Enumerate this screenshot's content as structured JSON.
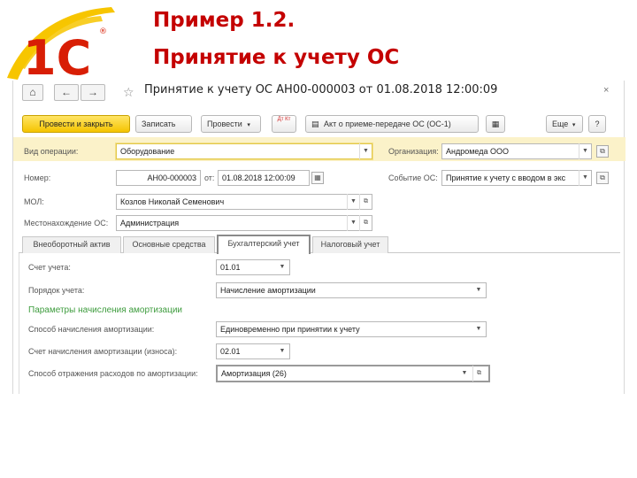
{
  "slide": {
    "title_line1": "Пример 1.2.",
    "title_line2": "Принятие к учету ОС",
    "logo_text": "1С",
    "logo_reg": "®"
  },
  "colors": {
    "title": "#c40000",
    "logo_red": "#d81e05",
    "logo_yellow": "#f7c500",
    "primary_button": "#f5c400"
  },
  "window": {
    "title": "Принятие к учету ОС АН00-000003 от 01.08.2018 12:00:09",
    "nav": {
      "home": "⌂",
      "back": "←",
      "forward": "→",
      "star": "☆",
      "close": "×"
    },
    "toolbar": {
      "post_close": "Провести и закрыть",
      "save": "Записать",
      "post": "Провести",
      "dt_kt": "Дт Кт",
      "act": "Акт о приеме-передаче ОС (ОС-1)",
      "more": "Еще",
      "help": "?"
    },
    "header": {
      "operation_label": "Вид операции:",
      "operation_value": "Оборудование",
      "organization_label": "Организация:",
      "organization_value": "Андромеда ООО",
      "number_label": "Номер:",
      "number_value": "АН00-000003",
      "from_label": "от:",
      "date_value": "01.08.2018 12:00:09",
      "event_label": "Событие ОС:",
      "event_value": "Принятие к учету с вводом в экс",
      "mol_label": "МОЛ:",
      "mol_value": "Козлов Николай Семенович",
      "location_label": "Местонахождение ОС:",
      "location_value": "Администрация"
    },
    "tabs": [
      "Внеоборотный актив",
      "Основные средства",
      "Бухгалтерский учет",
      "Налоговый учет"
    ],
    "accounting": {
      "account_label": "Счет учета:",
      "account_value": "01.01",
      "order_label": "Порядок учета:",
      "order_value": "Начисление амортизации",
      "params_header": "Параметры начисления амортизации",
      "method_label": "Способ начисления амортизации:",
      "method_value": "Единовременно при принятии к учету",
      "dep_account_label": "Счет начисления амортизации (износа):",
      "dep_account_value": "02.01",
      "expense_label": "Способ отражения расходов по амортизации:",
      "expense_value": "Амортизация (26)"
    }
  }
}
